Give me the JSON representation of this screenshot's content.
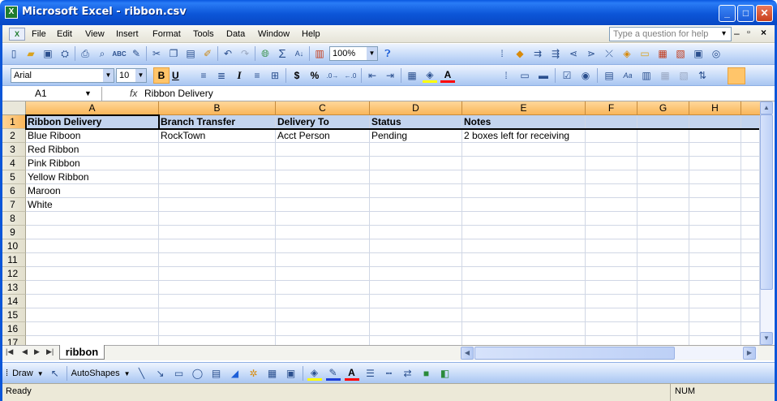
{
  "window": {
    "title": "Microsoft Excel - ribbon.csv",
    "icon": "X"
  },
  "menu": {
    "items": [
      "File",
      "Edit",
      "View",
      "Insert",
      "Format",
      "Tools",
      "Data",
      "Window",
      "Help"
    ],
    "question_placeholder": "Type a question for help"
  },
  "standard_toolbar": {
    "zoom": "100%"
  },
  "format_toolbar": {
    "font": "Arial",
    "size": "10",
    "bold": "B",
    "underline": "U",
    "italic": "I",
    "currency": "$",
    "percent": "%"
  },
  "formula_bar": {
    "name_box": "A1",
    "fx": "fx",
    "value": "Ribbon Delivery"
  },
  "grid": {
    "columns": [
      "A",
      "B",
      "C",
      "D",
      "E",
      "F",
      "G",
      "H"
    ],
    "rows": [
      "1",
      "2",
      "3",
      "4",
      "5",
      "6",
      "7",
      "8",
      "9",
      "10",
      "11",
      "12",
      "13",
      "14",
      "15",
      "16",
      "17"
    ],
    "cells": [
      [
        "Ribbon Delivery",
        "Branch Transfer",
        "Delivery To",
        "Status",
        "Notes"
      ],
      [
        "Blue Riboon",
        "RockTown",
        "Acct Person",
        "Pending",
        "2 boxes left for receiving"
      ],
      [
        "Red Ribbon",
        "",
        "",
        "",
        ""
      ],
      [
        "Pink Ribbon",
        "",
        "",
        "",
        ""
      ],
      [
        "Yellow Ribbon",
        "",
        "",
        "",
        ""
      ],
      [
        "Maroon",
        "",
        "",
        "",
        ""
      ],
      [
        "White",
        "",
        "",
        "",
        ""
      ]
    ]
  },
  "sheet_tabs": {
    "active": "ribbon"
  },
  "draw_toolbar": {
    "draw": "Draw",
    "autoshapes": "AutoShapes"
  },
  "status_bar": {
    "left": "Ready",
    "num": "NUM"
  },
  "colors": {
    "title_blue": "#0c56d8",
    "header_orange": "#f9b65a",
    "header_fill": "#c3d4ee"
  }
}
